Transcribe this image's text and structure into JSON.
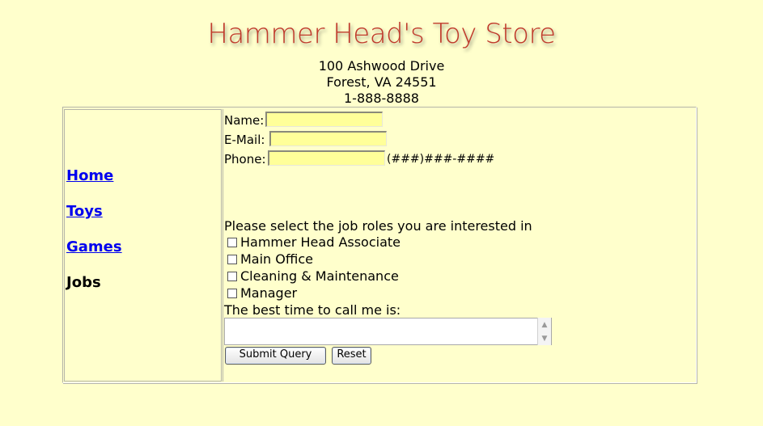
{
  "header": {
    "store_name": "Hammer Head's Toy Store",
    "address_line1": "100 Ashwood Drive",
    "address_line2": "Forest, VA 24551",
    "phone": "1-888-8888"
  },
  "nav": {
    "home": "Home",
    "toys": "Toys",
    "games": "Games",
    "jobs": "Jobs"
  },
  "form": {
    "name_label": "Name:",
    "name_value": "",
    "email_label": "E-Mail:",
    "email_value": "",
    "phone_label": "Phone:",
    "phone_value": "",
    "phone_format_hint": "(###)###-####",
    "roles_prompt": "Please select the job roles you are interested in",
    "roles": [
      {
        "label": "Hammer Head Associate",
        "checked": false
      },
      {
        "label": "Main Office",
        "checked": false
      },
      {
        "label": "Cleaning & Maintenance",
        "checked": false
      },
      {
        "label": "Manager",
        "checked": false
      }
    ],
    "call_time_label": "The best time to call me is:",
    "call_time_value": "",
    "submit_label": "Submit Query",
    "reset_label": "Reset"
  },
  "colors": {
    "page_background": "#ffffcc",
    "title_color": "#c0392b",
    "input_background": "#ffff99",
    "link_color": "#0000ee"
  }
}
